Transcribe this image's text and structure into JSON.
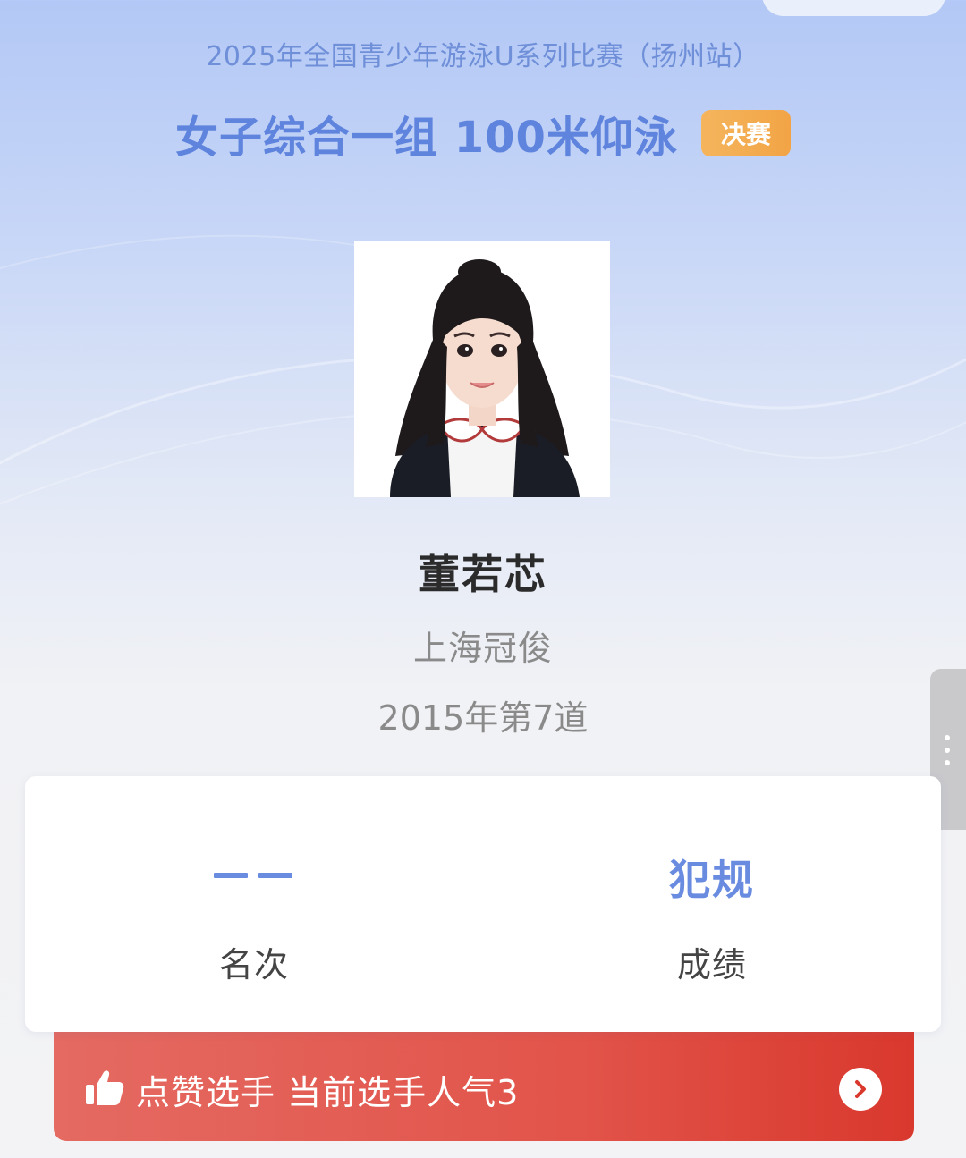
{
  "competition": {
    "title": "2025年全国青少年游泳U系列比赛（扬州站）"
  },
  "event": {
    "name": "女子综合一组 100米仰泳",
    "stage_badge": "决赛"
  },
  "athlete": {
    "photo": "athlete-portrait",
    "name": "董若芯",
    "club": "上海冠俊",
    "birth_lane": "2015年第7道"
  },
  "result": {
    "rank_value": "——",
    "rank_label": "名次",
    "score_value": "犯规",
    "score_label": "成绩"
  },
  "like_bar": {
    "icon": "thumbs-up-icon",
    "text": "点赞选手  当前选手人气3",
    "arrow_icon": "chevron-right-icon"
  },
  "colors": {
    "accent_blue": "#6a8ce0",
    "title_blue": "#5f84dd",
    "badge_orange": "#f2a445",
    "like_red": "#e2544a"
  }
}
